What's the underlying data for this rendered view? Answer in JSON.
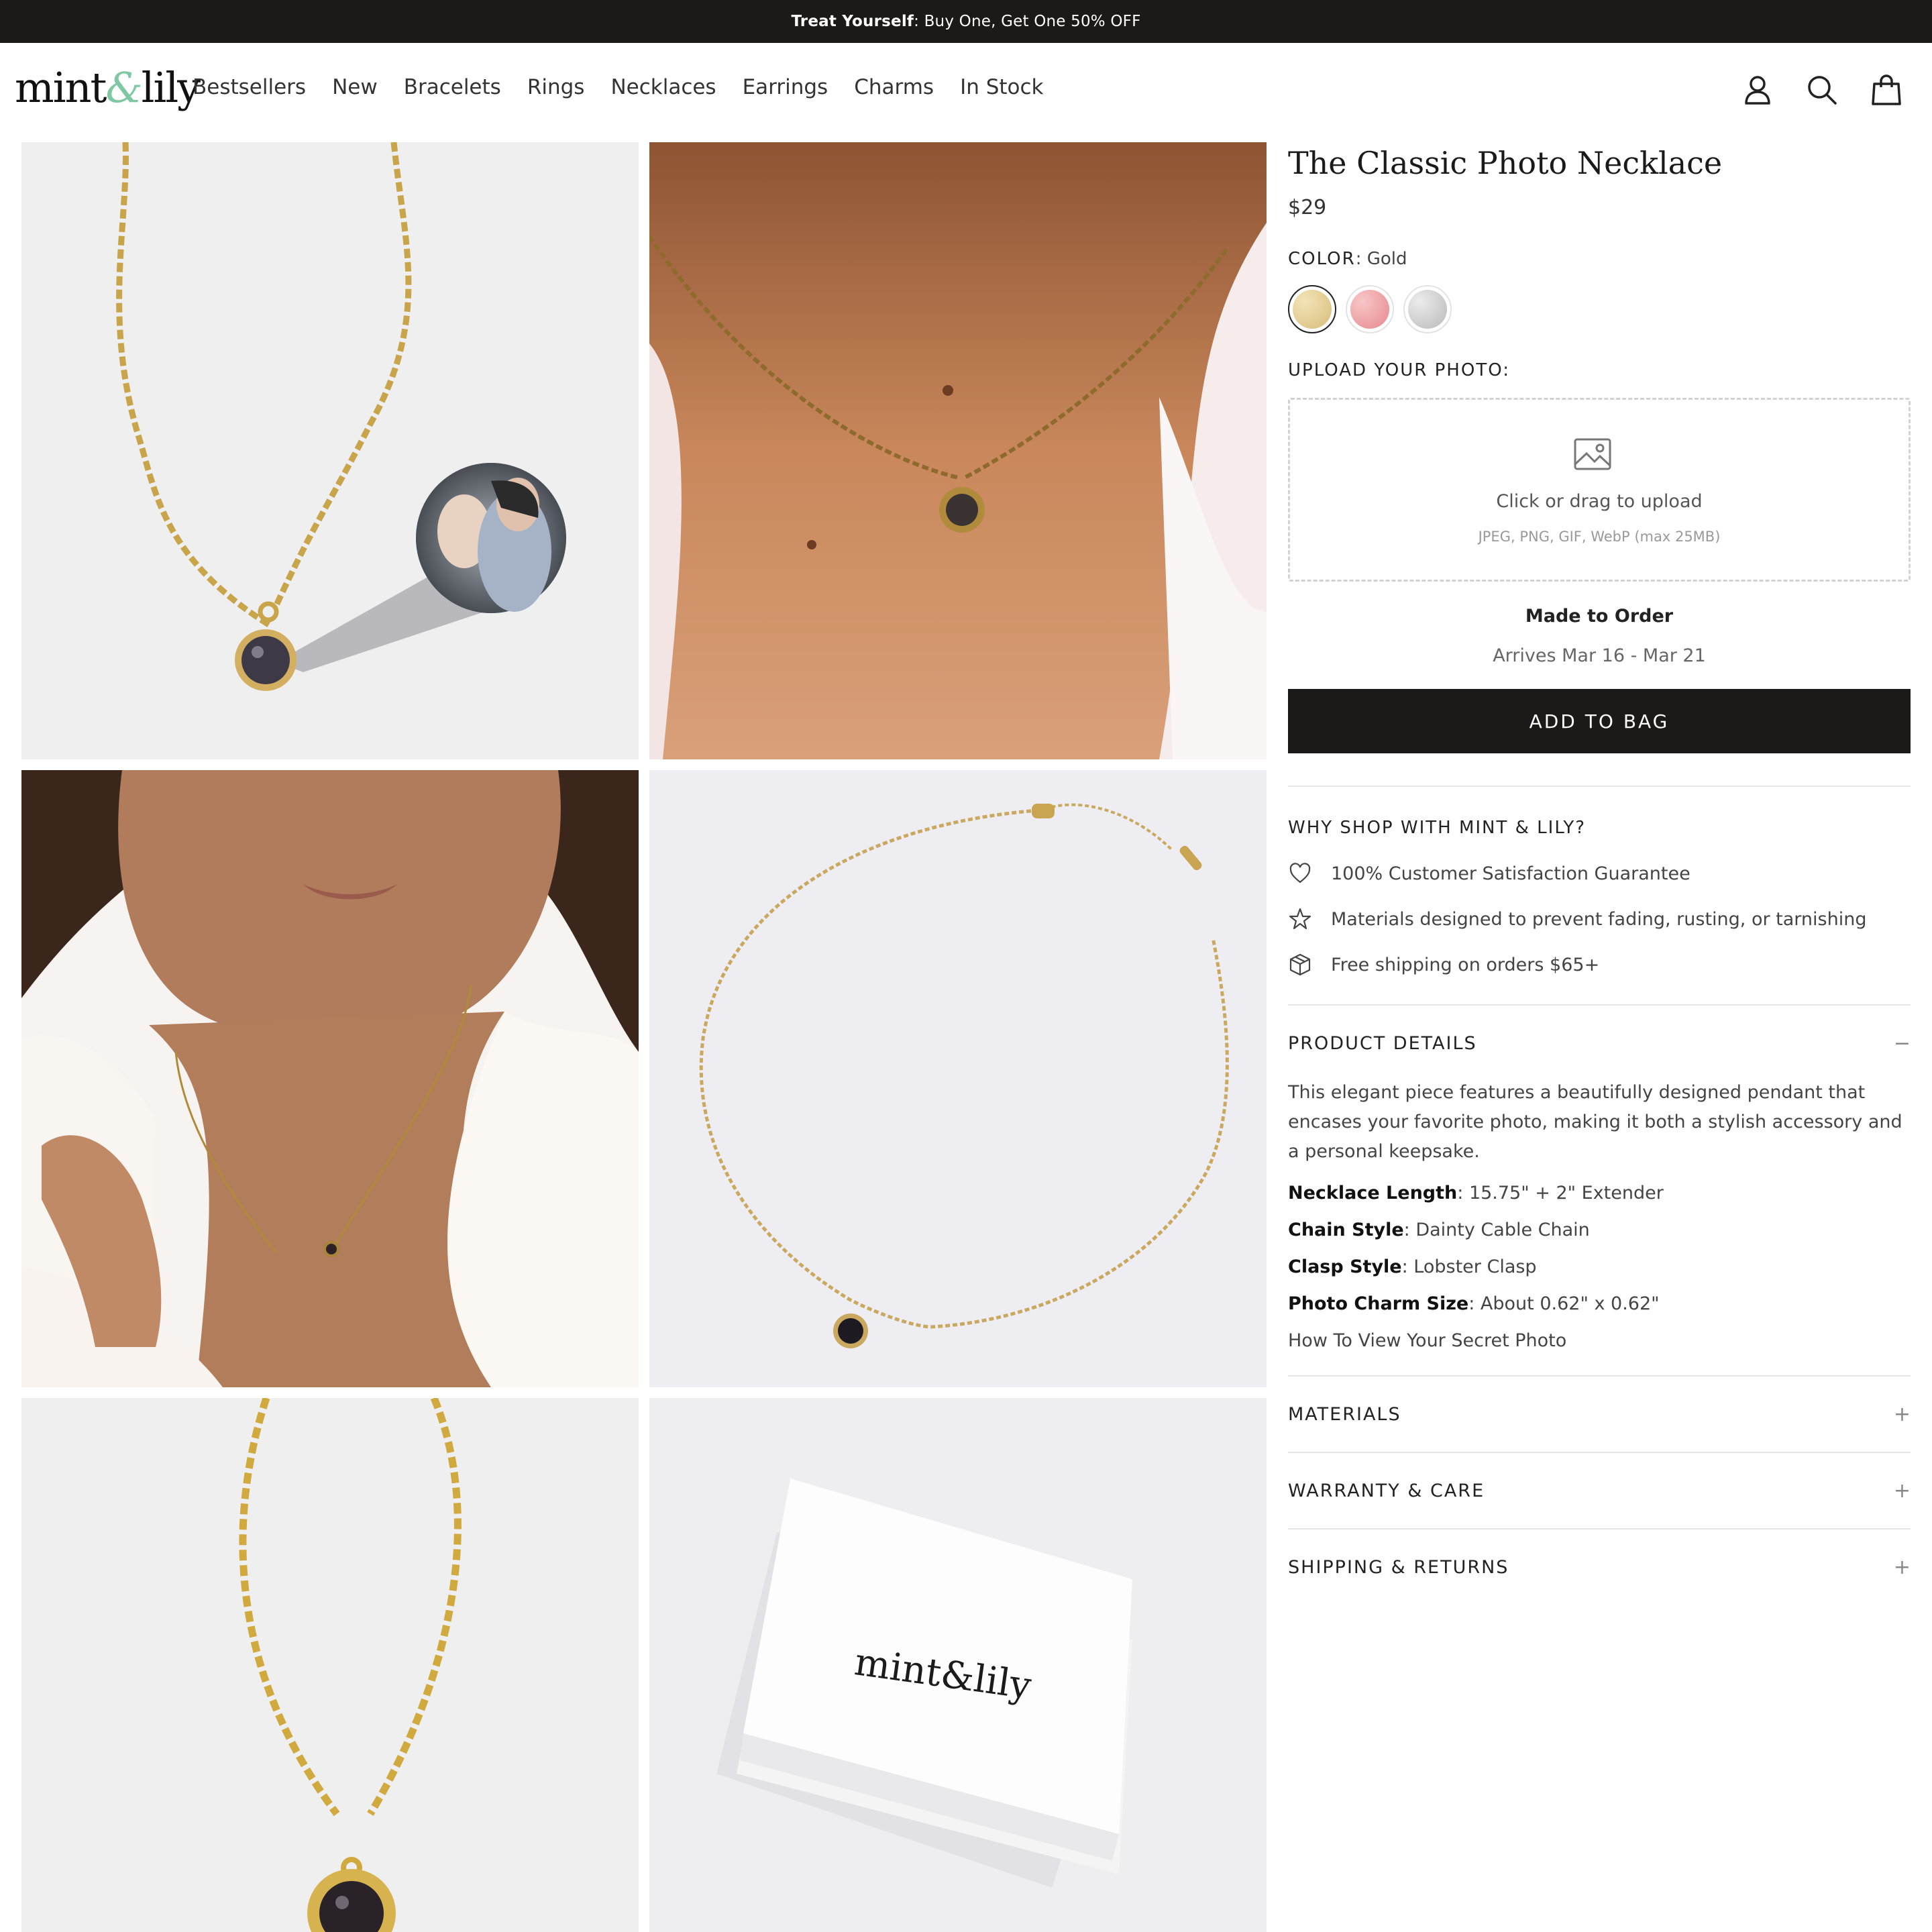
{
  "announcement": {
    "bold": "Treat Yourself",
    "rest": ": Buy One, Get One 50% OFF"
  },
  "brand": {
    "logo_left": "mint",
    "logo_amp": "&",
    "logo_right": "lily"
  },
  "nav": [
    "Bestsellers",
    "New",
    "Bracelets",
    "Rings",
    "Necklaces",
    "Earrings",
    "Charms",
    "In Stock"
  ],
  "header_icons": [
    "account-icon",
    "search-icon",
    "bag-icon"
  ],
  "gallery": [
    "necklace-with-photo-zoom",
    "necklace-on-neck-closeup",
    "model-wearing-necklace",
    "full-necklace-flatlay",
    "pendant-closeup",
    "gift-box"
  ],
  "box_logo": "mint&lily",
  "product": {
    "title": "The Classic Photo Necklace",
    "price": "$29",
    "color_label": "COLOR",
    "color_value": ": Gold",
    "swatches": [
      {
        "name": "Gold",
        "color": "#e3cd93"
      },
      {
        "name": "Rose Gold",
        "color": "#eda3a6"
      },
      {
        "name": "Silver",
        "color": "#c9c9c9"
      }
    ],
    "upload_label": "UPLOAD YOUR PHOTO:",
    "upload_text": "Click or drag to upload",
    "upload_formats": "JPEG, PNG, GIF, WebP (max 25MB)",
    "made_to_order": "Made to Order",
    "arrives": "Arrives Mar 16 - Mar 21",
    "add_to_bag": "ADD TO BAG"
  },
  "why": {
    "title": "WHY SHOP WITH MINT & LILY?",
    "items": [
      {
        "icon": "heart-icon",
        "text": "100% Customer Satisfaction Guarantee"
      },
      {
        "icon": "star-icon",
        "text": "Materials designed to prevent fading, rusting, or tarnishing"
      },
      {
        "icon": "box-icon",
        "text": "Free shipping on orders $65+"
      }
    ]
  },
  "details": {
    "title": "PRODUCT DETAILS",
    "toggle": "−",
    "description": "This elegant piece features a beautifully designed pendant that encases your favorite photo, making it both a stylish accessory and a personal keepsake.",
    "specs": [
      {
        "label": "Necklace Length",
        "value": ": 15.75\" + 2\" Extender"
      },
      {
        "label": "Chain Style",
        "value": ": Dainty Cable Chain"
      },
      {
        "label": "Clasp Style",
        "value": ": Lobster Clasp"
      },
      {
        "label": "Photo Charm Size",
        "value": ": About 0.62\" x 0.62\""
      }
    ],
    "link": "How To View Your Secret Photo"
  },
  "accordions": [
    {
      "title": "MATERIALS",
      "toggle": "+"
    },
    {
      "title": "WARRANTY & CARE",
      "toggle": "+"
    },
    {
      "title": "SHIPPING & RETURNS",
      "toggle": "+"
    }
  ]
}
